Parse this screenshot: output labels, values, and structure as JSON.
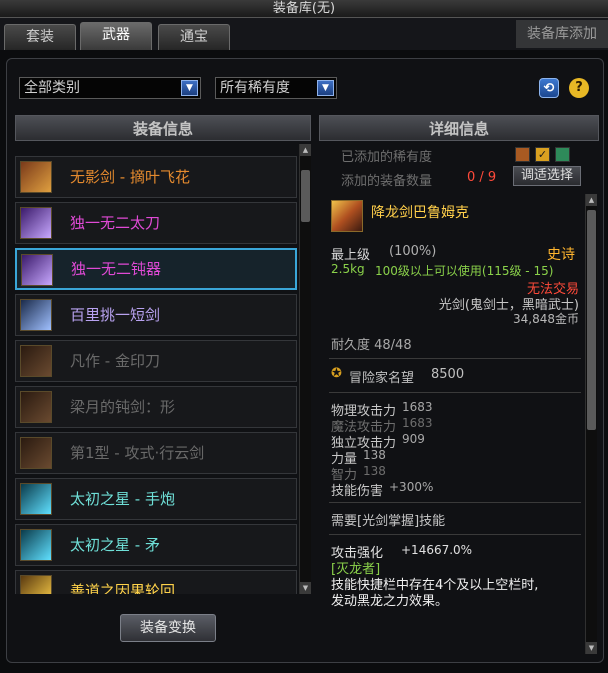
{
  "window": {
    "title": "装备库(无)"
  },
  "tabs": [
    {
      "label": "套装"
    },
    {
      "label": "武器"
    },
    {
      "label": "通宝"
    }
  ],
  "side_tab": {
    "label": "装备库添加"
  },
  "filters": {
    "category": "全部类别",
    "rarity": "所有稀有度"
  },
  "list": {
    "header": "装备信息",
    "items": [
      {
        "name": "无影剑 - 摘叶飞花",
        "color": "#e48a2e"
      },
      {
        "name": "独一无二太刀",
        "color": "#e04ad6"
      },
      {
        "name": "独一无二钝器",
        "color": "#e04ad6"
      },
      {
        "name": "百里挑一短剑",
        "color": "#b8a2f0"
      },
      {
        "name": "凡作 - 金印刀",
        "color": "#6a6a6a"
      },
      {
        "name": "梁月的钝剑：形",
        "color": "#6a6a6a"
      },
      {
        "name": "第1型 - 攻式·行云剑",
        "color": "#6a6a6a"
      },
      {
        "name": "太初之星 - 手炮",
        "color": "#6fe0d8"
      },
      {
        "name": "太初之星 - 矛",
        "color": "#6fe0d8"
      },
      {
        "name": "善道之因果轮回",
        "color": "#ffd24a"
      }
    ],
    "selected_index": 2,
    "transform_button": "装备变换"
  },
  "detail": {
    "header": "详细信息",
    "rarity_added_label": "已添加的稀有度",
    "count_label": "添加的装备数量",
    "count_value": "0 / 9",
    "adjust_button": "调适选择",
    "item_name": "降龙剑巴鲁姆克",
    "level_label": "最上级",
    "level_pct": "(100%)",
    "rarity": "史诗",
    "weight": "2.5kg",
    "req_level": "100级以上可以使用(115级 - 15)",
    "trade": "无法交易",
    "weapon_type": "光剑(鬼剑士，黑暗武士)",
    "price": "34,848金币",
    "durability": "耐久度 48/48",
    "fame_label": "冒险家名望",
    "fame_value": "8500",
    "stats": [
      {
        "label": "物理攻击力",
        "value": "1683",
        "bright": true
      },
      {
        "label": "魔法攻击力",
        "value": "1683",
        "bright": false
      },
      {
        "label": "独立攻击力",
        "value": "909",
        "bright": true
      },
      {
        "label": "力量",
        "value": "138",
        "bright": true
      },
      {
        "label": "智力",
        "value": "138",
        "bright": false
      },
      {
        "label": "技能伤害",
        "value": "+300%",
        "bright": true
      }
    ],
    "requirement": "需要[光剑掌握]技能",
    "attack_enhance_label": "攻击强化",
    "attack_enhance_value": "+14667.0%",
    "skill_name": "[灭龙者]",
    "skill_desc_1": "技能快捷栏中存在4个及以上空栏时,",
    "skill_desc_2": "发动黑龙之力效果。"
  },
  "colors": {
    "epic": "#ffb52e",
    "cannot_trade": "#ff4a3a",
    "item_name": "#ffcf4a",
    "green_text": "#8ad14a",
    "selected_border": "#3aa6d8"
  }
}
